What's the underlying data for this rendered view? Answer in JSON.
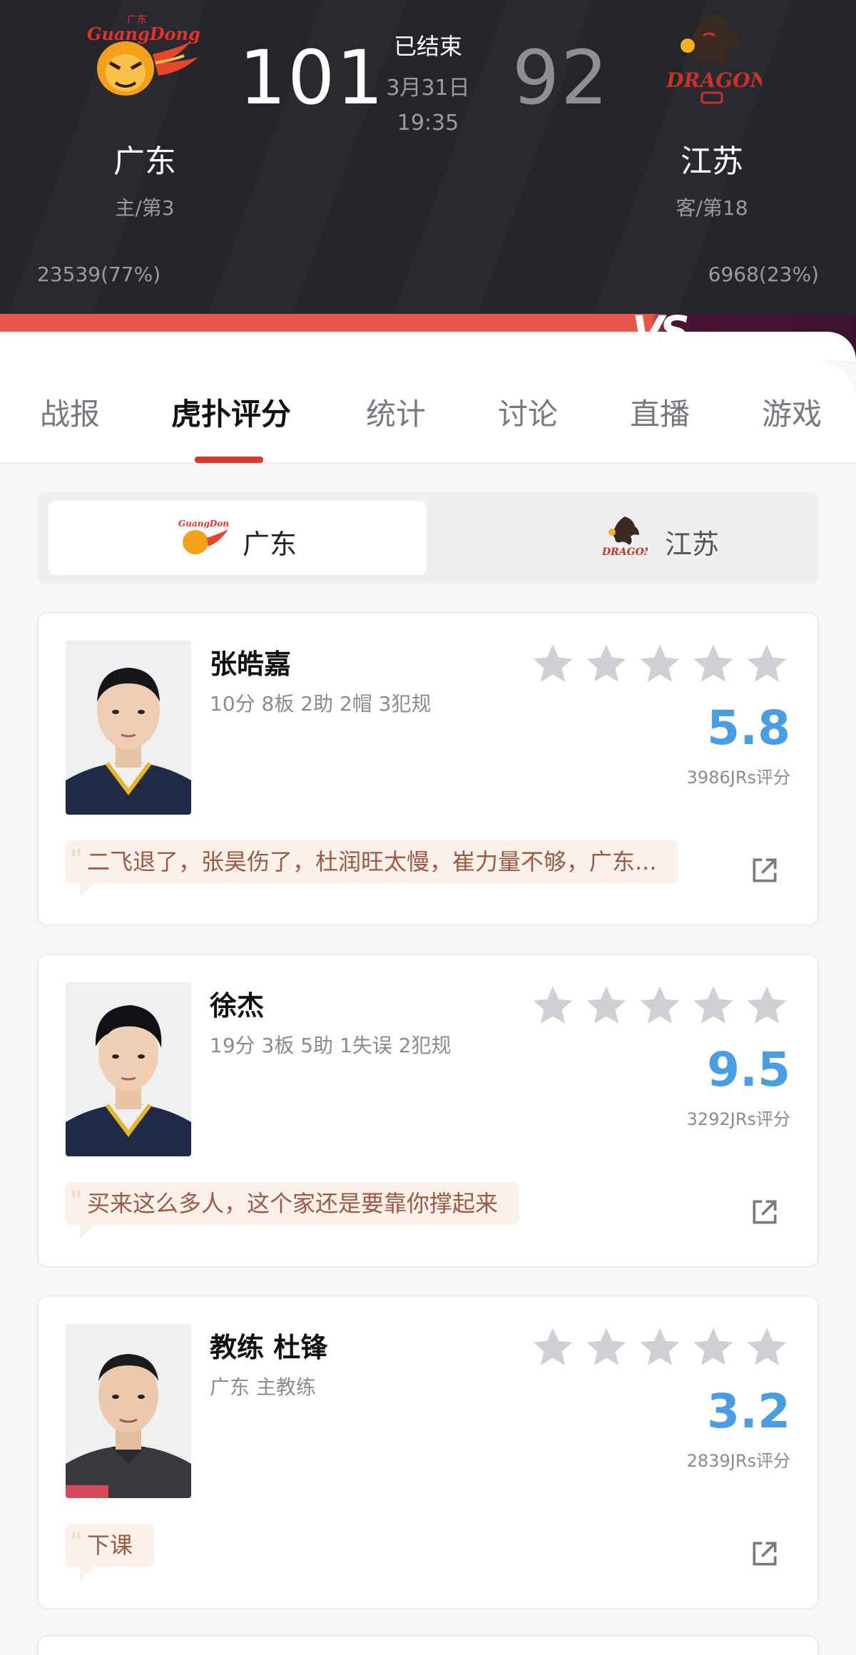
{
  "match": {
    "home": {
      "name": "广东",
      "rank": "主/第3",
      "score": "101",
      "support": "23539(77%)",
      "logo_text": "广东",
      "logo_brand": "GuangDong"
    },
    "away": {
      "name": "江苏",
      "rank": "客/第18",
      "score": "92",
      "support": "6968(23%)",
      "logo_brand": "DRAGONS"
    },
    "status": "已结束",
    "date": "3月31日",
    "time": "19:35",
    "vs_label": "VS"
  },
  "tabs": [
    {
      "label": "战报"
    },
    {
      "label": "虎扑评分",
      "active": true
    },
    {
      "label": "统计"
    },
    {
      "label": "讨论"
    },
    {
      "label": "直播"
    },
    {
      "label": "游戏"
    }
  ],
  "team_switch": {
    "home_label": "广东",
    "away_label": "江苏",
    "selected": "广东"
  },
  "players": [
    {
      "name": "张皓嘉",
      "stats": "10分 8板 2助 2帽 3犯规",
      "rating": "5.8",
      "votes": "3986JRs评分",
      "stars_filled": 0,
      "comment": "二飞退了，张昊伤了，杜润旺太慢，崔力量不够，广东..."
    },
    {
      "name": "徐杰",
      "stats": "19分 3板 5助 1失误 2犯规",
      "rating": "9.5",
      "votes": "3292JRs评分",
      "stars_filled": 0,
      "comment": "买来这么多人，这个家还是要靠你撑起来"
    },
    {
      "name": "教练 杜锋",
      "stats": "广东 主教练",
      "rating": "3.2",
      "votes": "2839JRs评分",
      "stars_filled": 0,
      "comment": "下课"
    }
  ],
  "colors": {
    "header_bg": "#24252b",
    "accent_red": "#d9392f",
    "rating_blue": "#4a9de2",
    "star_gray": "#cfd0d6",
    "comment_bg": "#fcf1ea",
    "comment_text": "#9b5a43"
  },
  "icons": {
    "share": "share-external-icon",
    "star": "star-icon"
  }
}
